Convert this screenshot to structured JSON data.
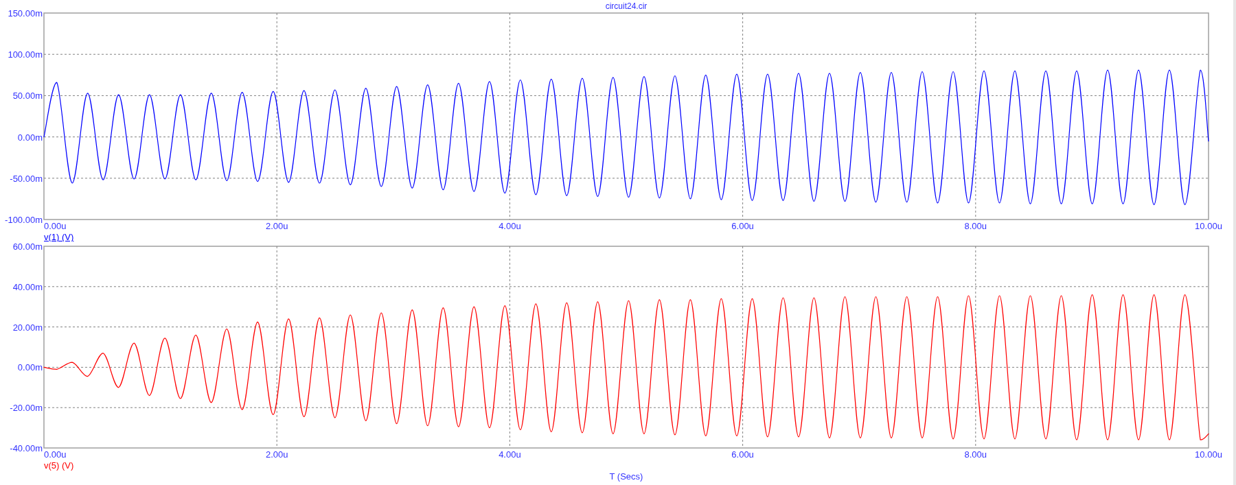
{
  "charts": [
    {
      "trace_selected": true,
      "chart_data": {
        "type": "line",
        "grid": true,
        "title": "circuit24.cir",
        "x": [
          0,
          0.11,
          0.243,
          0.375,
          0.508,
          0.641,
          0.774,
          0.906,
          1.039,
          1.172,
          1.304,
          1.437,
          1.57,
          1.702,
          1.835,
          1.968,
          2.101,
          2.233,
          2.366,
          2.499,
          2.631,
          2.764,
          2.897,
          3.029,
          3.162,
          3.295,
          3.428,
          3.56,
          3.693,
          3.826,
          3.958,
          4.091,
          4.224,
          4.356,
          4.489,
          4.622,
          4.755,
          4.887,
          5.02,
          5.153,
          5.285,
          5.418,
          5.551,
          5.683,
          5.816,
          5.949,
          6.082,
          6.214,
          6.347,
          6.48,
          6.612,
          6.745,
          6.878,
          7.01,
          7.143,
          7.276,
          7.409,
          7.541,
          7.674,
          7.807,
          7.939,
          8.072,
          8.205,
          8.337,
          8.47,
          8.603,
          8.736,
          8.868,
          9.001,
          9.134,
          9.266,
          9.399,
          9.532,
          9.664,
          9.797,
          9.93,
          10
        ],
        "series": [
          {
            "name": "v(1) (V)",
            "color": "#0000ff",
            "values": [
              0,
              66,
              -56,
              53,
              -52,
              51,
              -51,
              51,
              -51,
              51,
              -52,
              53,
              -53,
              54,
              -54,
              55,
              -55,
              56,
              -56,
              57,
              -58,
              59,
              -60,
              61,
              -62,
              63,
              -64,
              65,
              -66,
              67,
              -68,
              69,
              -70,
              70,
              -71,
              71,
              -72,
              72,
              -73,
              73,
              -74,
              74,
              -75,
              75,
              -76,
              76,
              -77,
              76,
              -77,
              77,
              -78,
              77,
              -78,
              78,
              -79,
              78,
              -79,
              79,
              -80,
              79,
              -80,
              80,
              -80,
              80,
              -81,
              80,
              -81,
              80,
              -81,
              81,
              -81,
              81,
              -82,
              81,
              -82,
              81,
              -5
            ]
          }
        ],
        "xlim": [
          0,
          10
        ],
        "ylim": [
          -100,
          150
        ],
        "xticks": [
          {
            "value": 0,
            "label": "0.00u"
          },
          {
            "value": 2,
            "label": "2.00u"
          },
          {
            "value": 4,
            "label": "4.00u"
          },
          {
            "value": 6,
            "label": "6.00u"
          },
          {
            "value": 8,
            "label": "8.00u"
          },
          {
            "value": 10,
            "label": "10.00u"
          }
        ],
        "yticks": [
          {
            "value": -100,
            "label": "-100.00m"
          },
          {
            "value": -50,
            "label": "-50.00m"
          },
          {
            "value": 0,
            "label": "0.00m"
          },
          {
            "value": 50,
            "label": "50.00m"
          },
          {
            "value": 100,
            "label": "100.00m"
          },
          {
            "value": 150,
            "label": "150.00m"
          }
        ]
      }
    },
    {
      "trace_selected": false,
      "chart_data": {
        "type": "line",
        "grid": true,
        "xlabel": "T (Secs)",
        "x": [
          0,
          0.11,
          0.243,
          0.375,
          0.508,
          0.641,
          0.774,
          0.906,
          1.039,
          1.172,
          1.304,
          1.437,
          1.57,
          1.702,
          1.835,
          1.968,
          2.101,
          2.233,
          2.366,
          2.499,
          2.631,
          2.764,
          2.897,
          3.029,
          3.162,
          3.295,
          3.428,
          3.56,
          3.693,
          3.826,
          3.958,
          4.091,
          4.224,
          4.356,
          4.489,
          4.622,
          4.755,
          4.887,
          5.02,
          5.153,
          5.285,
          5.418,
          5.551,
          5.683,
          5.816,
          5.949,
          6.082,
          6.214,
          6.347,
          6.48,
          6.612,
          6.745,
          6.878,
          7.01,
          7.143,
          7.276,
          7.409,
          7.541,
          7.674,
          7.807,
          7.939,
          8.072,
          8.205,
          8.337,
          8.47,
          8.603,
          8.736,
          8.868,
          9.001,
          9.134,
          9.266,
          9.399,
          9.532,
          9.664,
          9.797,
          9.93,
          10
        ],
        "series": [
          {
            "name": "v(5) (V)",
            "color": "#ff0000",
            "values": [
              0,
              -1,
              2.5,
              -4.5,
              7,
              -10,
              12,
              -14,
              14.5,
              -15.5,
              16,
              -17.5,
              19,
              -21,
              22.5,
              -23.5,
              24,
              -24.5,
              24.5,
              -25,
              26,
              -26.5,
              27,
              -28,
              28.5,
              -29,
              29.5,
              -29.5,
              30,
              -30,
              30.5,
              -31,
              31.5,
              -32,
              32,
              -32.5,
              32.5,
              -33,
              33,
              -33,
              33.5,
              -33.5,
              33.5,
              -34,
              34,
              -34,
              34,
              -34.5,
              34.5,
              -34.5,
              34.5,
              -35,
              35,
              -35,
              35,
              -35,
              35,
              -35,
              35,
              -35.5,
              35.5,
              -35.5,
              35.5,
              -35.5,
              35.5,
              -35.5,
              35.5,
              -36,
              36,
              -36,
              36,
              -36,
              36,
              -36,
              36,
              -36,
              -33
            ]
          }
        ],
        "xlim": [
          0,
          10
        ],
        "ylim": [
          -40,
          60
        ],
        "xticks": [
          {
            "value": 0,
            "label": "0.00u"
          },
          {
            "value": 2,
            "label": "2.00u"
          },
          {
            "value": 4,
            "label": "4.00u"
          },
          {
            "value": 6,
            "label": "6.00u"
          },
          {
            "value": 8,
            "label": "8.00u"
          },
          {
            "value": 10,
            "label": "10.00u"
          }
        ],
        "yticks": [
          {
            "value": -40,
            "label": "-40.00m"
          },
          {
            "value": -20,
            "label": "-20.00m"
          },
          {
            "value": 0,
            "label": "0.00m"
          },
          {
            "value": 20,
            "label": "20.00m"
          },
          {
            "value": 40,
            "label": "40.00m"
          },
          {
            "value": 60,
            "label": "60.00m"
          }
        ]
      }
    }
  ]
}
